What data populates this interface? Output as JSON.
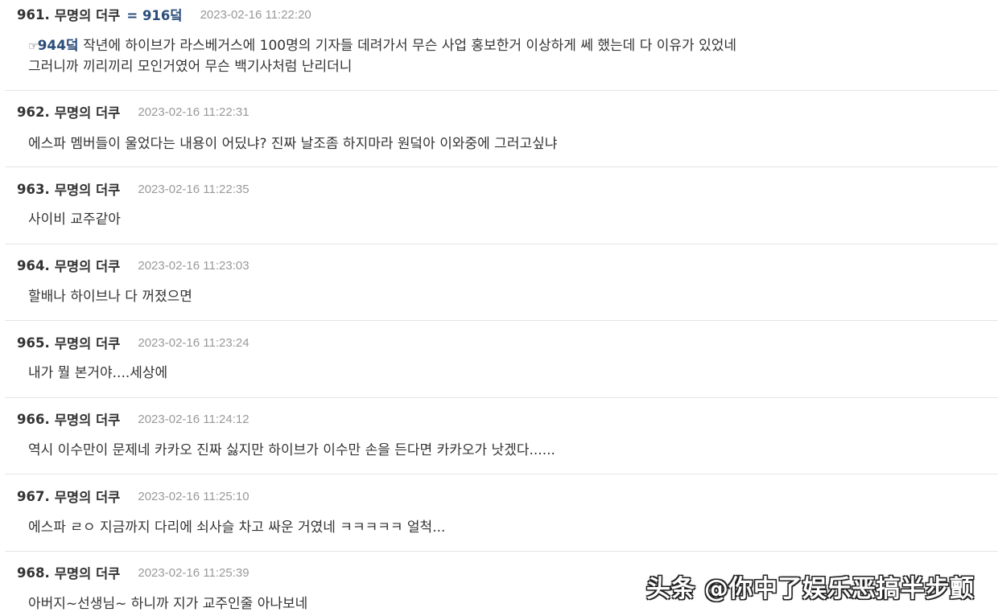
{
  "comments": [
    {
      "number": "961.",
      "author": "무명의 더쿠",
      "anchor": "= 916덬",
      "date": "2023-02-16 11:22:20",
      "quote_icon": "☞",
      "quote": "944덬",
      "line1": " 작년에 하이브가 라스베거스에 100명의 기자들 데려가서 무슨 사업 홍보한거 이상하게 쎄 했는데 다 이유가 있었네",
      "line2": "그러니까 끼리끼리 모인거였어 무슨 백기사처럼 난리더니"
    },
    {
      "number": "962.",
      "author": "무명의 더쿠",
      "date": "2023-02-16 11:22:31",
      "text": "에스파 멤버들이 울었다는 내용이 어딨냐? 진짜 날조좀 하지마라 원덬아 이와중에 그러고싶냐"
    },
    {
      "number": "963.",
      "author": "무명의 더쿠",
      "date": "2023-02-16 11:22:35",
      "text": "사이비 교주같아"
    },
    {
      "number": "964.",
      "author": "무명의 더쿠",
      "date": "2023-02-16 11:23:03",
      "text": "할배나 하이브나 다 꺼졌으면"
    },
    {
      "number": "965.",
      "author": "무명의 더쿠",
      "date": "2023-02-16 11:23:24",
      "text": "내가 뭘 본거야....세상에"
    },
    {
      "number": "966.",
      "author": "무명의 더쿠",
      "date": "2023-02-16 11:24:12",
      "text": "역시 이수만이 문제네 카카오 진짜 싫지만 하이브가 이수만 손을 든다면 카카오가 낫겠다......"
    },
    {
      "number": "967.",
      "author": "무명의 더쿠",
      "date": "2023-02-16 11:25:10",
      "text": "에스파 ㄹㅇ 지금까지 다리에 쇠사슬 차고 싸운 거였네 ㅋㅋㅋㅋㅋ 얼척..."
    },
    {
      "number": "968.",
      "author": "무명의 더쿠",
      "date": "2023-02-16 11:25:39",
      "text": "아버지~선생님~ 하니까 지가 교주인줄 아나보네"
    }
  ],
  "watermark": "头条 @你中了娱乐恶搞半步颤"
}
